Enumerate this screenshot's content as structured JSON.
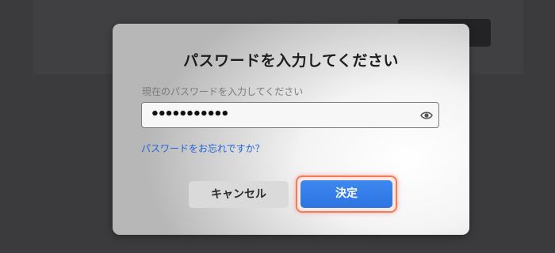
{
  "dialog": {
    "title": "パスワードを入力してください",
    "field_label": "現在のパスワードを入力してください",
    "password_value": "•••••••••••",
    "forgot_link": "パスワードをお忘れですか？",
    "cancel_label": "キャンセル",
    "confirm_label": "決定"
  },
  "icons": {
    "reveal": "eye-icon"
  },
  "colors": {
    "accent": "#2f7ae5",
    "link": "#1f63d6",
    "highlight": "#f27a5e"
  }
}
